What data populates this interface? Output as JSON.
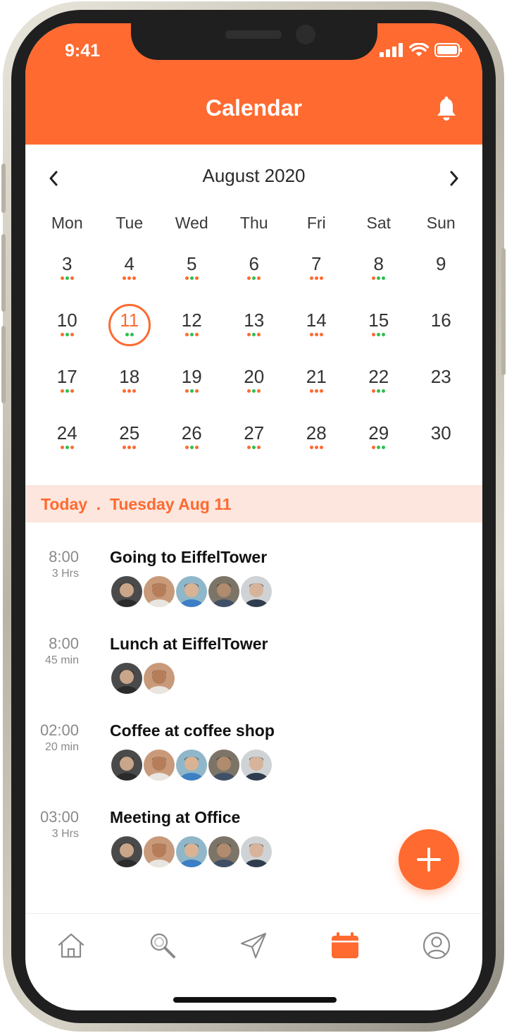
{
  "status_bar": {
    "time": "9:41"
  },
  "header": {
    "title": "Calendar",
    "bell_icon": "bell-icon"
  },
  "calendar": {
    "month_label": "August 2020",
    "weekdays": [
      "Mon",
      "Tue",
      "Wed",
      "Thu",
      "Fri",
      "Sat",
      "Sun"
    ],
    "selected_day": "11",
    "weeks": [
      [
        {
          "d": "3",
          "dots": [
            "o",
            "g",
            "o"
          ]
        },
        {
          "d": "4",
          "dots": [
            "o",
            "o",
            "o"
          ]
        },
        {
          "d": "5",
          "dots": [
            "o",
            "g",
            "o"
          ]
        },
        {
          "d": "6",
          "dots": [
            "o",
            "g",
            "o"
          ]
        },
        {
          "d": "7",
          "dots": [
            "o",
            "o",
            "o"
          ]
        },
        {
          "d": "8",
          "dots": [
            "o",
            "g",
            "g"
          ]
        },
        {
          "d": "9",
          "dots": []
        }
      ],
      [
        {
          "d": "10",
          "dots": [
            "o",
            "g",
            "o"
          ]
        },
        {
          "d": "11",
          "dots": [
            "g",
            "g"
          ]
        },
        {
          "d": "12",
          "dots": [
            "o",
            "g",
            "o"
          ]
        },
        {
          "d": "13",
          "dots": [
            "o",
            "g",
            "o"
          ]
        },
        {
          "d": "14",
          "dots": [
            "o",
            "o",
            "o"
          ]
        },
        {
          "d": "15",
          "dots": [
            "o",
            "g",
            "g"
          ]
        },
        {
          "d": "16",
          "dots": []
        }
      ],
      [
        {
          "d": "17",
          "dots": [
            "o",
            "g",
            "o"
          ]
        },
        {
          "d": "18",
          "dots": [
            "o",
            "o",
            "o"
          ]
        },
        {
          "d": "19",
          "dots": [
            "o",
            "g",
            "o"
          ]
        },
        {
          "d": "20",
          "dots": [
            "o",
            "g",
            "o"
          ]
        },
        {
          "d": "21",
          "dots": [
            "o",
            "o",
            "o"
          ]
        },
        {
          "d": "22",
          "dots": [
            "o",
            "g",
            "g"
          ]
        },
        {
          "d": "23",
          "dots": []
        }
      ],
      [
        {
          "d": "24",
          "dots": [
            "o",
            "g",
            "o"
          ]
        },
        {
          "d": "25",
          "dots": [
            "o",
            "o",
            "o"
          ]
        },
        {
          "d": "26",
          "dots": [
            "o",
            "g",
            "o"
          ]
        },
        {
          "d": "27",
          "dots": [
            "o",
            "g",
            "o"
          ]
        },
        {
          "d": "28",
          "dots": [
            "o",
            "o",
            "o"
          ]
        },
        {
          "d": "29",
          "dots": [
            "o",
            "g",
            "g"
          ]
        },
        {
          "d": "30",
          "dots": []
        }
      ]
    ]
  },
  "today_bar": {
    "text": "Today  .  Tuesday Aug 11"
  },
  "events": [
    {
      "time": "8:00",
      "duration": "3 Hrs",
      "title": "Going to EiffelTower",
      "avatars": 5
    },
    {
      "time": "8:00",
      "duration": "45 min",
      "title": "Lunch at EiffelTower",
      "avatars": 2
    },
    {
      "time": "02:00",
      "duration": "20 min",
      "title": "Coffee at coffee shop",
      "avatars": 5
    },
    {
      "time": "03:00",
      "duration": "3 Hrs",
      "title": "Meeting at Office",
      "avatars": 5
    }
  ],
  "fab": {
    "icon": "plus-icon"
  },
  "tabbar": {
    "tabs": [
      {
        "icon": "home-icon",
        "active": false
      },
      {
        "icon": "search-icon",
        "active": false
      },
      {
        "icon": "send-icon",
        "active": false
      },
      {
        "icon": "calendar-icon",
        "active": true
      },
      {
        "icon": "profile-icon",
        "active": false
      }
    ]
  },
  "colors": {
    "accent": "#fe6a30",
    "dot_green": "#2ebf4f",
    "today_bg": "#fce6dd",
    "inactive_icon": "#8a8a8a"
  }
}
